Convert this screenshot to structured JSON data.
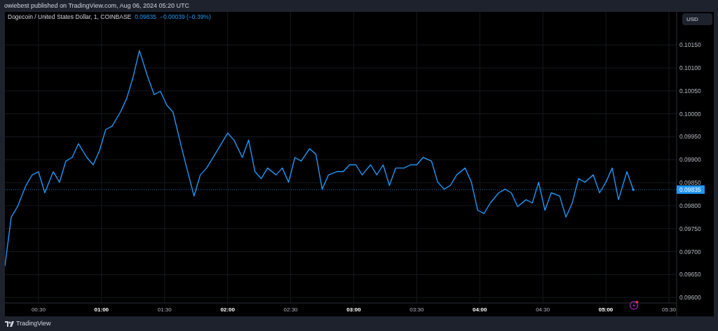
{
  "header": {
    "published_text": "owiebest published on TradingView.com, Aug 06, 2024 05:20 UTC"
  },
  "chart": {
    "legend": {
      "symbol": "Dogecoin / United States Dollar, 1, COINBASE",
      "price": "0.09835",
      "change": "−0.00039 (−0.39%)"
    },
    "currency_button": "USD",
    "last_price_label": "0.09835",
    "chart_data": {
      "type": "line",
      "x": [
        14,
        17,
        20,
        24,
        27,
        30,
        33,
        37,
        40,
        43,
        46,
        49,
        53,
        56,
        59,
        62,
        65,
        69,
        72,
        75,
        78,
        82,
        85,
        88,
        91,
        94,
        98,
        101,
        104,
        107,
        110,
        114,
        117,
        120,
        123,
        127,
        130,
        133,
        136,
        139,
        143,
        146,
        149,
        152,
        155,
        159,
        162,
        165,
        168,
        172,
        175,
        178,
        181,
        184,
        188,
        191,
        194,
        197,
        200,
        204,
        207,
        210,
        213,
        217,
        220,
        223,
        226,
        229,
        233,
        236,
        239,
        242,
        245,
        249,
        252,
        255,
        258,
        262,
        265,
        268,
        271,
        274,
        278,
        281,
        284,
        287,
        290,
        294,
        297,
        300,
        303,
        306,
        310,
        313
      ],
      "xlim": [
        14,
        333.67
      ],
      "ylim": [
        0.09588,
        0.10222
      ],
      "grid": true,
      "ref_lines": [
        {
          "axis": "y",
          "value": 0.09835,
          "color": "#2196f3"
        }
      ],
      "series": [
        {
          "color": "#2196f3",
          "values": [
            0.09668,
            0.09775,
            0.09798,
            0.09844,
            0.09867,
            0.09874,
            0.09828,
            0.09874,
            0.09851,
            0.09897,
            0.09905,
            0.09935,
            0.09905,
            0.09889,
            0.0992,
            0.09966,
            0.09973,
            0.10004,
            0.10034,
            0.1008,
            0.10138,
            0.1008,
            0.10042,
            0.10049,
            0.10019,
            0.10004,
            0.09928,
            0.09874,
            0.09821,
            0.09867,
            0.09882,
            0.09912,
            0.09935,
            0.09958,
            0.09943,
            0.09905,
            0.09943,
            0.09874,
            0.09859,
            0.09882,
            0.09867,
            0.09882,
            0.09851,
            0.09905,
            0.09897,
            0.09924,
            0.09912,
            0.09836,
            0.09867,
            0.09874,
            0.09874,
            0.09889,
            0.09889,
            0.09867,
            0.09889,
            0.09867,
            0.09889,
            0.09844,
            0.09882,
            0.09882,
            0.09889,
            0.09889,
            0.09905,
            0.09897,
            0.09851,
            0.09836,
            0.09844,
            0.09867,
            0.09882,
            0.09851,
            0.0979,
            0.09783,
            0.09806,
            0.09828,
            0.09836,
            0.09828,
            0.09798,
            0.09813,
            0.09806,
            0.09851,
            0.0979,
            0.09828,
            0.09821,
            0.09775,
            0.09806,
            0.09859,
            0.09851,
            0.09867,
            0.09828,
            0.09851,
            0.09882,
            0.09813,
            0.09874,
            0.09835
          ]
        }
      ],
      "xticks": [
        {
          "value": 30,
          "label": "00:30"
        },
        {
          "value": 60,
          "label": "01:00"
        },
        {
          "value": 90,
          "label": "01:30"
        },
        {
          "value": 120,
          "label": "02:00"
        },
        {
          "value": 150,
          "label": "02:30"
        },
        {
          "value": 180,
          "label": "03:00"
        },
        {
          "value": 210,
          "label": "03:30"
        },
        {
          "value": 240,
          "label": "04:00"
        },
        {
          "value": 270,
          "label": "04:30"
        },
        {
          "value": 300,
          "label": "05:00"
        },
        {
          "value": 330,
          "label": "05:30"
        }
      ],
      "yticks": [
        {
          "value": 0.1015,
          "label": "0.10150"
        },
        {
          "value": 0.101,
          "label": "0.10100"
        },
        {
          "value": 0.1005,
          "label": "0.10050"
        },
        {
          "value": 0.1,
          "label": "0.10000"
        },
        {
          "value": 0.0995,
          "label": "0.09950"
        },
        {
          "value": 0.099,
          "label": "0.09900"
        },
        {
          "value": 0.0985,
          "label": "0.09850"
        },
        {
          "value": 0.098,
          "label": "0.09800"
        },
        {
          "value": 0.0975,
          "label": "0.09750"
        },
        {
          "value": 0.097,
          "label": "0.09700"
        },
        {
          "value": 0.0965,
          "label": "0.09650"
        },
        {
          "value": 0.096,
          "label": "0.09600"
        }
      ]
    }
  },
  "footer": {
    "brand": "TradingView"
  }
}
